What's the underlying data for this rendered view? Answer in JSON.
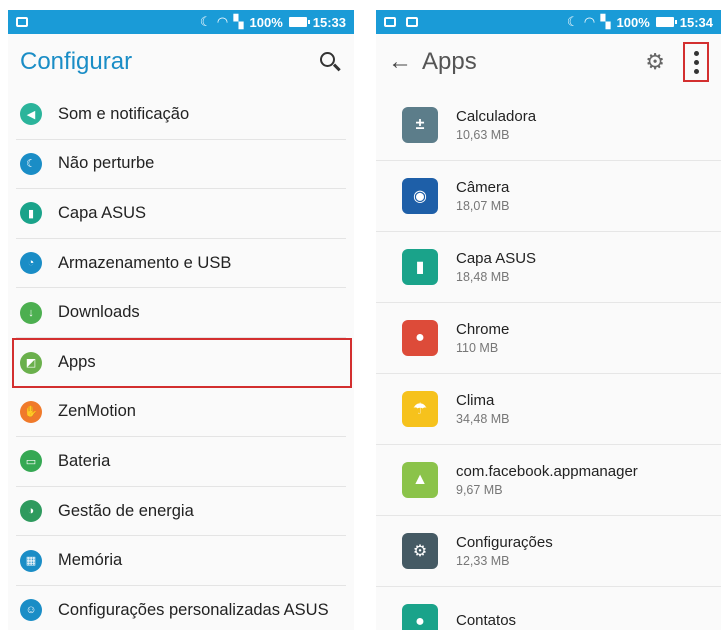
{
  "left": {
    "status": {
      "battery": "100%",
      "time": "15:33"
    },
    "title": "Configurar",
    "items": [
      {
        "label": "Som e notificação",
        "color": "#2bb49b",
        "glyph": "◀"
      },
      {
        "label": "Não perturbe",
        "color": "#1a8dc6",
        "glyph": "☾"
      },
      {
        "label": "Capa ASUS",
        "color": "#1aa38a",
        "glyph": "▮"
      },
      {
        "label": "Armazenamento e USB",
        "color": "#1a8dc6",
        "glyph": "◔"
      },
      {
        "label": "Downloads",
        "color": "#4caf50",
        "glyph": "↓"
      },
      {
        "label": "Apps",
        "color": "#6ab04c",
        "glyph": "◩"
      },
      {
        "label": "ZenMotion",
        "color": "#f07a2a",
        "glyph": "✋"
      },
      {
        "label": "Bateria",
        "color": "#35a853",
        "glyph": "▭"
      },
      {
        "label": "Gestão de energia",
        "color": "#2e9a5e",
        "glyph": "◑"
      },
      {
        "label": "Memória",
        "color": "#1a8dc6",
        "glyph": "▦"
      },
      {
        "label": "Configurações personalizadas ASUS",
        "color": "#1a8dc6",
        "glyph": "☺"
      }
    ]
  },
  "right": {
    "status": {
      "battery": "100%",
      "time": "15:34"
    },
    "title": "Apps",
    "apps": [
      {
        "name": "Calculadora",
        "size": "10,63 MB",
        "color": "#5c7d8a",
        "glyph": "±"
      },
      {
        "name": "Câmera",
        "size": "18,07 MB",
        "color": "#1e5fa8",
        "glyph": "◉"
      },
      {
        "name": "Capa ASUS",
        "size": "18,48 MB",
        "color": "#1aa38a",
        "glyph": "▮"
      },
      {
        "name": "Chrome",
        "size": "110 MB",
        "color": "#dd4b39",
        "glyph": "●"
      },
      {
        "name": "Clima",
        "size": "34,48 MB",
        "color": "#f6c21c",
        "glyph": "☂"
      },
      {
        "name": "com.facebook.appmanager",
        "size": "9,67 MB",
        "color": "#8bc34a",
        "glyph": "▲"
      },
      {
        "name": "Configurações",
        "size": "12,33 MB",
        "color": "#455a64",
        "glyph": "⚙"
      },
      {
        "name": "Contatos",
        "size": "",
        "color": "#1aa38a",
        "glyph": "●"
      }
    ]
  }
}
